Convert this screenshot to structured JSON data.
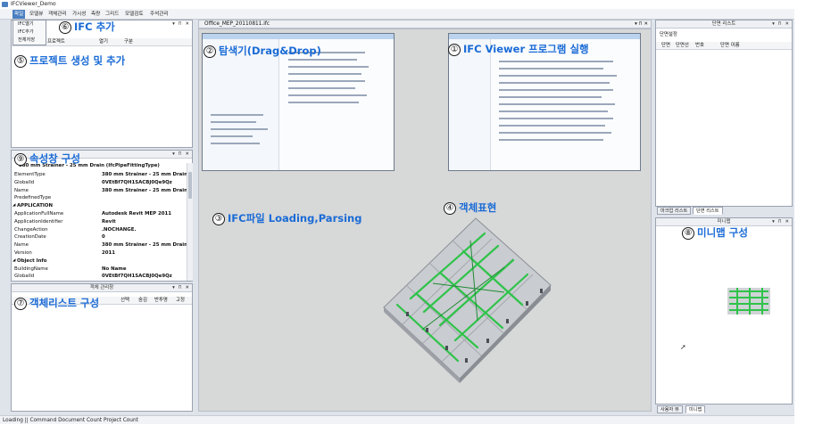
{
  "window": {
    "title": "IFCViewer_Demo"
  },
  "menu": {
    "items": [
      "파일",
      "모델뷰",
      "객체관리",
      "가시성",
      "측량",
      "그리드",
      "모델검토",
      "주석관리"
    ],
    "active_index": 0
  },
  "file_menu": {
    "items": [
      "IFC열기",
      "IFC추가",
      "전체저장"
    ]
  },
  "project_panel": {
    "columns": [
      "프로젝트",
      "열기",
      "구분"
    ]
  },
  "document_tab": {
    "label": "Office_MEP_20110811.ifc"
  },
  "property_panel": {
    "header_row": "380 mm Strainer - 25 mm Drain (IfcPipeFittingType)",
    "rows": [
      {
        "key": "ElementType",
        "value": "380 mm Strainer - 25 mm Drain",
        "category": false
      },
      {
        "key": "GlobalId",
        "value": "0VEtBf7QH1SACBJ0Qe9Qz",
        "category": false
      },
      {
        "key": "Name",
        "value": "380 mm Strainer - 25 mm Drain",
        "category": false
      },
      {
        "key": "PredefinedType",
        "value": "",
        "category": false
      },
      {
        "key": "APPLICATION",
        "value": "",
        "category": true
      },
      {
        "key": "ApplicationFullName",
        "value": "Autodesk Revit MEP 2011",
        "category": false
      },
      {
        "key": "ApplicationIdentifier",
        "value": "Revit",
        "category": false
      },
      {
        "key": "ChangeAction",
        "value": ".NOCHANGE.",
        "category": false
      },
      {
        "key": "CreationDate",
        "value": "0",
        "category": false
      },
      {
        "key": "Name",
        "value": "380 mm Strainer - 25 mm Drain",
        "category": false
      },
      {
        "key": "Version",
        "value": "2011",
        "category": false
      },
      {
        "key": "Object Info",
        "value": "",
        "category": true
      },
      {
        "key": "BuildingName",
        "value": "No Name",
        "category": false
      },
      {
        "key": "GlobalId",
        "value": "0VEtBf7QH1SACBJ0Qe9Qz",
        "category": false
      }
    ]
  },
  "object_panel": {
    "title": "객체 관리창",
    "columns": [
      "선택",
      "숨김",
      "반투명",
      "고정"
    ]
  },
  "section_panel": {
    "title": "단면 리스트",
    "subtitle": "단면설정",
    "columns": [
      "단면",
      "단면선",
      "번호",
      "단면 이름"
    ]
  },
  "right_tabs": [
    "마크업 리스트",
    "단면 리스트"
  ],
  "minimap_panel": {
    "title": "미니맵"
  },
  "bottom_right_tabs": [
    "사용자 뷰",
    "미니맵"
  ],
  "status_bar": {
    "text": "Loading  ||  Command  Document Count  Project Count"
  },
  "annotations": [
    {
      "num": "①",
      "text": "IFC Viewer 프로그램 실행"
    },
    {
      "num": "②",
      "text": "탐색기(Drag&Drop)"
    },
    {
      "num": "③",
      "text": "IFC파일 Loading,Parsing"
    },
    {
      "num": "④",
      "text": "객체표현"
    },
    {
      "num": "⑤",
      "text": "프로젝트 생성 및 추가"
    },
    {
      "num": "⑥",
      "text": "IFC 추가"
    },
    {
      "num": "⑦",
      "text": "객체리스트 구성"
    },
    {
      "num": "⑧",
      "text": "미니맵 구성"
    },
    {
      "num": "⑨",
      "text": "속성창 구성"
    }
  ],
  "panel_controls": "▾ ⊓ ✕",
  "colors": {
    "accent": "#4a7fc1",
    "annotation": "#1a6bd6",
    "pipe_green": "#2fc34a",
    "slab": "#c9ccd0"
  }
}
